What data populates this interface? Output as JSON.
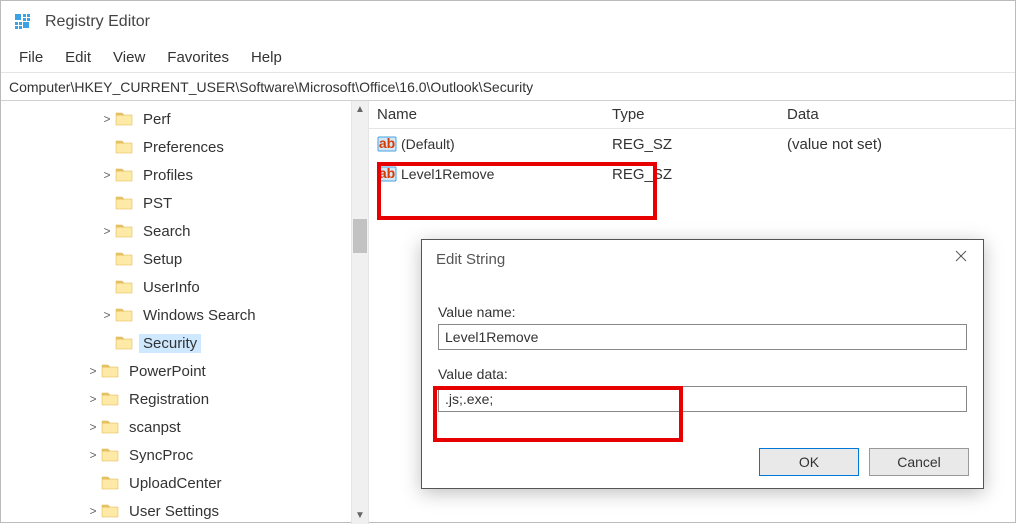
{
  "title": "Registry Editor",
  "menu": [
    "File",
    "Edit",
    "View",
    "Favorites",
    "Help"
  ],
  "address": "Computer\\HKEY_CURRENT_USER\\Software\\Microsoft\\Office\\16.0\\Outlook\\Security",
  "tree": [
    {
      "indent": 3,
      "expander": ">",
      "label": "Perf"
    },
    {
      "indent": 3,
      "expander": "",
      "label": "Preferences"
    },
    {
      "indent": 3,
      "expander": ">",
      "label": "Profiles"
    },
    {
      "indent": 3,
      "expander": "",
      "label": "PST"
    },
    {
      "indent": 3,
      "expander": ">",
      "label": "Search"
    },
    {
      "indent": 3,
      "expander": "",
      "label": "Setup"
    },
    {
      "indent": 3,
      "expander": "",
      "label": "UserInfo"
    },
    {
      "indent": 3,
      "expander": ">",
      "label": "Windows Search"
    },
    {
      "indent": 3,
      "expander": "",
      "label": "Security",
      "selected": true
    },
    {
      "indent": 2,
      "expander": ">",
      "label": "PowerPoint"
    },
    {
      "indent": 2,
      "expander": ">",
      "label": "Registration"
    },
    {
      "indent": 2,
      "expander": ">",
      "label": "scanpst"
    },
    {
      "indent": 2,
      "expander": ">",
      "label": "SyncProc"
    },
    {
      "indent": 2,
      "expander": "",
      "label": "UploadCenter"
    },
    {
      "indent": 2,
      "expander": ">",
      "label": "User Settings"
    }
  ],
  "columns": {
    "name": "Name",
    "type": "Type",
    "data": "Data"
  },
  "values": [
    {
      "icon": "ab",
      "name": "(Default)",
      "type": "REG_SZ",
      "data": "(value not set)"
    },
    {
      "icon": "ab",
      "name": "Level1Remove",
      "type": "REG_SZ",
      "data": ""
    }
  ],
  "dialog": {
    "title": "Edit String",
    "value_name_label": "Value name:",
    "value_name": "Level1Remove",
    "value_data_label": "Value data:",
    "value_data": ".js;.exe;",
    "ok": "OK",
    "cancel": "Cancel"
  }
}
